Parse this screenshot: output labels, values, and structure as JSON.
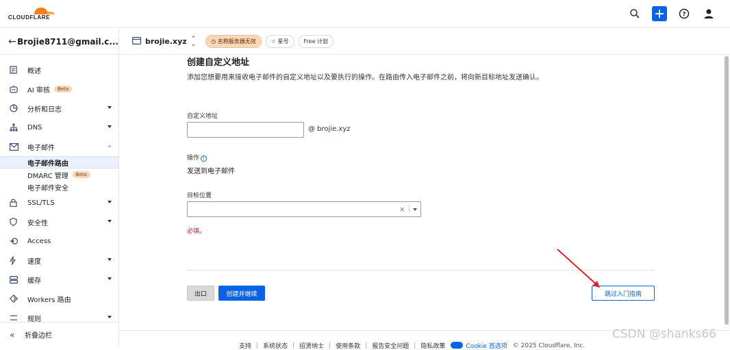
{
  "header": {
    "logo_text": "CLOUDFLARE",
    "icons": [
      "search-icon",
      "plus-icon",
      "help-icon",
      "user-icon"
    ],
    "brand_color": "#F38020",
    "accent_color": "#0A63E6"
  },
  "sidebar": {
    "account": "Brojie8711@gmail.c...",
    "items": [
      {
        "label": "概述",
        "icon": "overview-icon"
      },
      {
        "label": "AI 审核",
        "icon": "ai-icon",
        "badge": "Beta"
      },
      {
        "label": "分析和日志",
        "icon": "analytics-icon"
      },
      {
        "label": "DNS",
        "icon": "dns-icon"
      },
      {
        "label": "电子邮件",
        "icon": "email-icon"
      },
      {
        "label": "SSL/TLS",
        "icon": "lock-icon"
      },
      {
        "label": "安全性",
        "icon": "shield-icon"
      },
      {
        "label": "Access",
        "icon": "access-icon"
      },
      {
        "label": "速度",
        "icon": "bolt-icon"
      },
      {
        "label": "缓存",
        "icon": "cache-icon"
      },
      {
        "label": "Workers 路由",
        "icon": "workers-icon"
      },
      {
        "label": "规则",
        "icon": "rules-icon"
      }
    ],
    "email_sub": [
      {
        "label": "电子邮件路由",
        "active": true
      },
      {
        "label": "DMARC 管理",
        "badge": "Beta"
      },
      {
        "label": "电子邮件安全"
      }
    ],
    "collapse_label": "折叠边栏"
  },
  "domain_bar": {
    "domain": "brojie.xyz",
    "status_chip": "名称服务器无效",
    "star_chip": "星号",
    "plan_chip": "Free 计划"
  },
  "main": {
    "title": "创建自定义地址",
    "description": "添加您想要用来接收电子邮件的自定义地址以及要执行的操作。在路由传入电子邮件之前，将向新目标地址发送确认。",
    "custom_address_label": "自定义地址",
    "custom_address_value": "",
    "at_domain": "@  brojie.xyz",
    "action_label": "操作",
    "action_value": "发送到电子邮件",
    "destination_label": "目标位置",
    "destination_value": "",
    "required_text": "必填。",
    "exit_button": "出口",
    "create_button": "创建并继续",
    "skip_button": "跳过入门指南"
  },
  "footer": {
    "links": [
      "支持",
      "系统状态",
      "招贤纳士",
      "使用条款",
      "报告安全问题",
      "隐私政策"
    ],
    "cookie_label": "Cookie 首选项",
    "copyright": "© 2025 Cloudflare, Inc."
  },
  "watermark": "CSDN @shanks66"
}
